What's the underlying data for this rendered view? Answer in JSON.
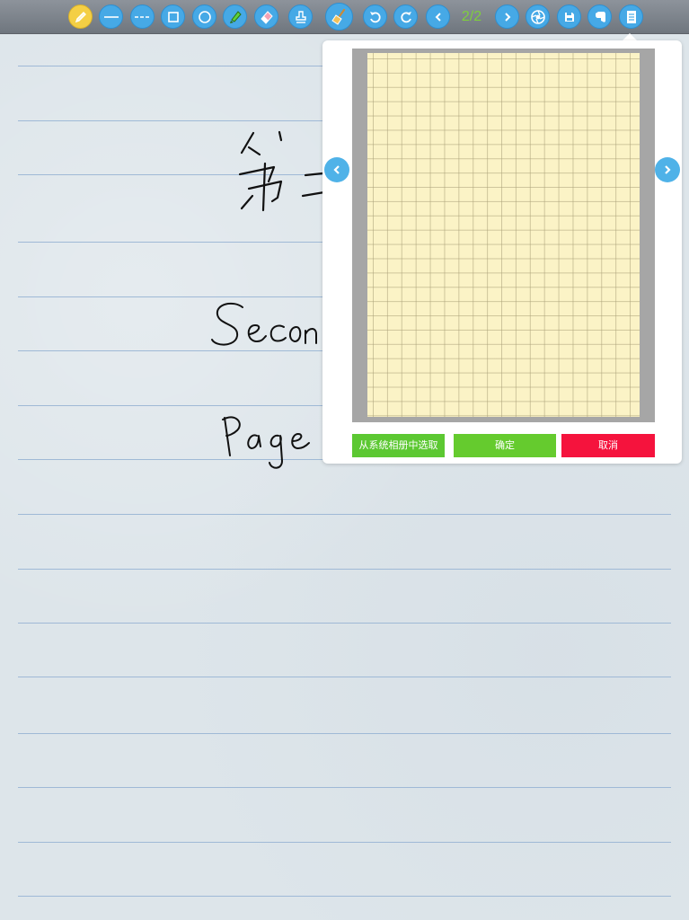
{
  "toolbar": {
    "page_counter": "2/2",
    "tools": [
      {
        "name": "pencil-icon"
      },
      {
        "name": "line-icon"
      },
      {
        "name": "dashed-line-icon"
      },
      {
        "name": "rectangle-icon"
      },
      {
        "name": "circle-icon"
      },
      {
        "name": "highlighter-icon"
      },
      {
        "name": "eraser-icon"
      },
      {
        "name": "stamp-icon"
      },
      {
        "name": "broom-icon"
      },
      {
        "name": "undo-icon"
      },
      {
        "name": "redo-icon"
      },
      {
        "name": "previous-page-icon"
      },
      {
        "name": "next-page-icon"
      },
      {
        "name": "share-icon"
      },
      {
        "name": "save-icon"
      },
      {
        "name": "evernote-icon"
      },
      {
        "name": "paper-template-icon"
      }
    ]
  },
  "popover": {
    "choose_from_album_label": "从系统相册中选取",
    "confirm_label": "确定",
    "cancel_label": "取消",
    "colors": {
      "album_button": "#5cc832",
      "confirm_button": "#65cb2e",
      "cancel_button": "#f5133d"
    }
  },
  "canvas": {
    "handwriting": [
      "第二",
      "Secon",
      "Page"
    ]
  }
}
